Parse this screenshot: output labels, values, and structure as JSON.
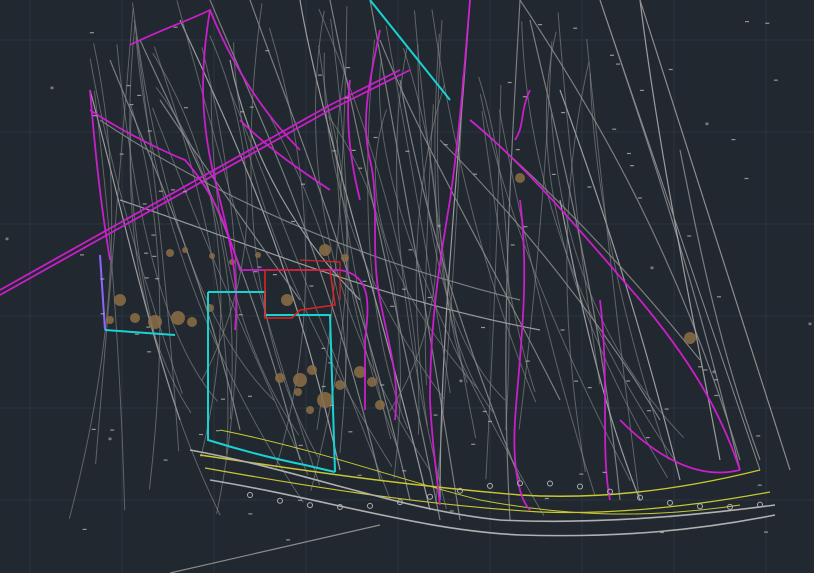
{
  "colors": {
    "background": "#212830",
    "grid": "#2c3540",
    "linework": "#8c8c8c",
    "linework_light": "#b0b0b0",
    "magenta": "#d21fd2",
    "cyan": "#19d2d2",
    "red": "#dc2323",
    "yellow": "#c8c832",
    "brown": "#8c6e46",
    "purple": "#8a66ff"
  },
  "layers": [
    {
      "name": "contours",
      "color": "linework"
    },
    {
      "name": "boundary",
      "color": "magenta"
    },
    {
      "name": "parcel",
      "color": "cyan"
    },
    {
      "name": "building",
      "color": "red"
    },
    {
      "name": "road",
      "color": "yellow"
    },
    {
      "name": "trees",
      "color": "brown"
    }
  ]
}
